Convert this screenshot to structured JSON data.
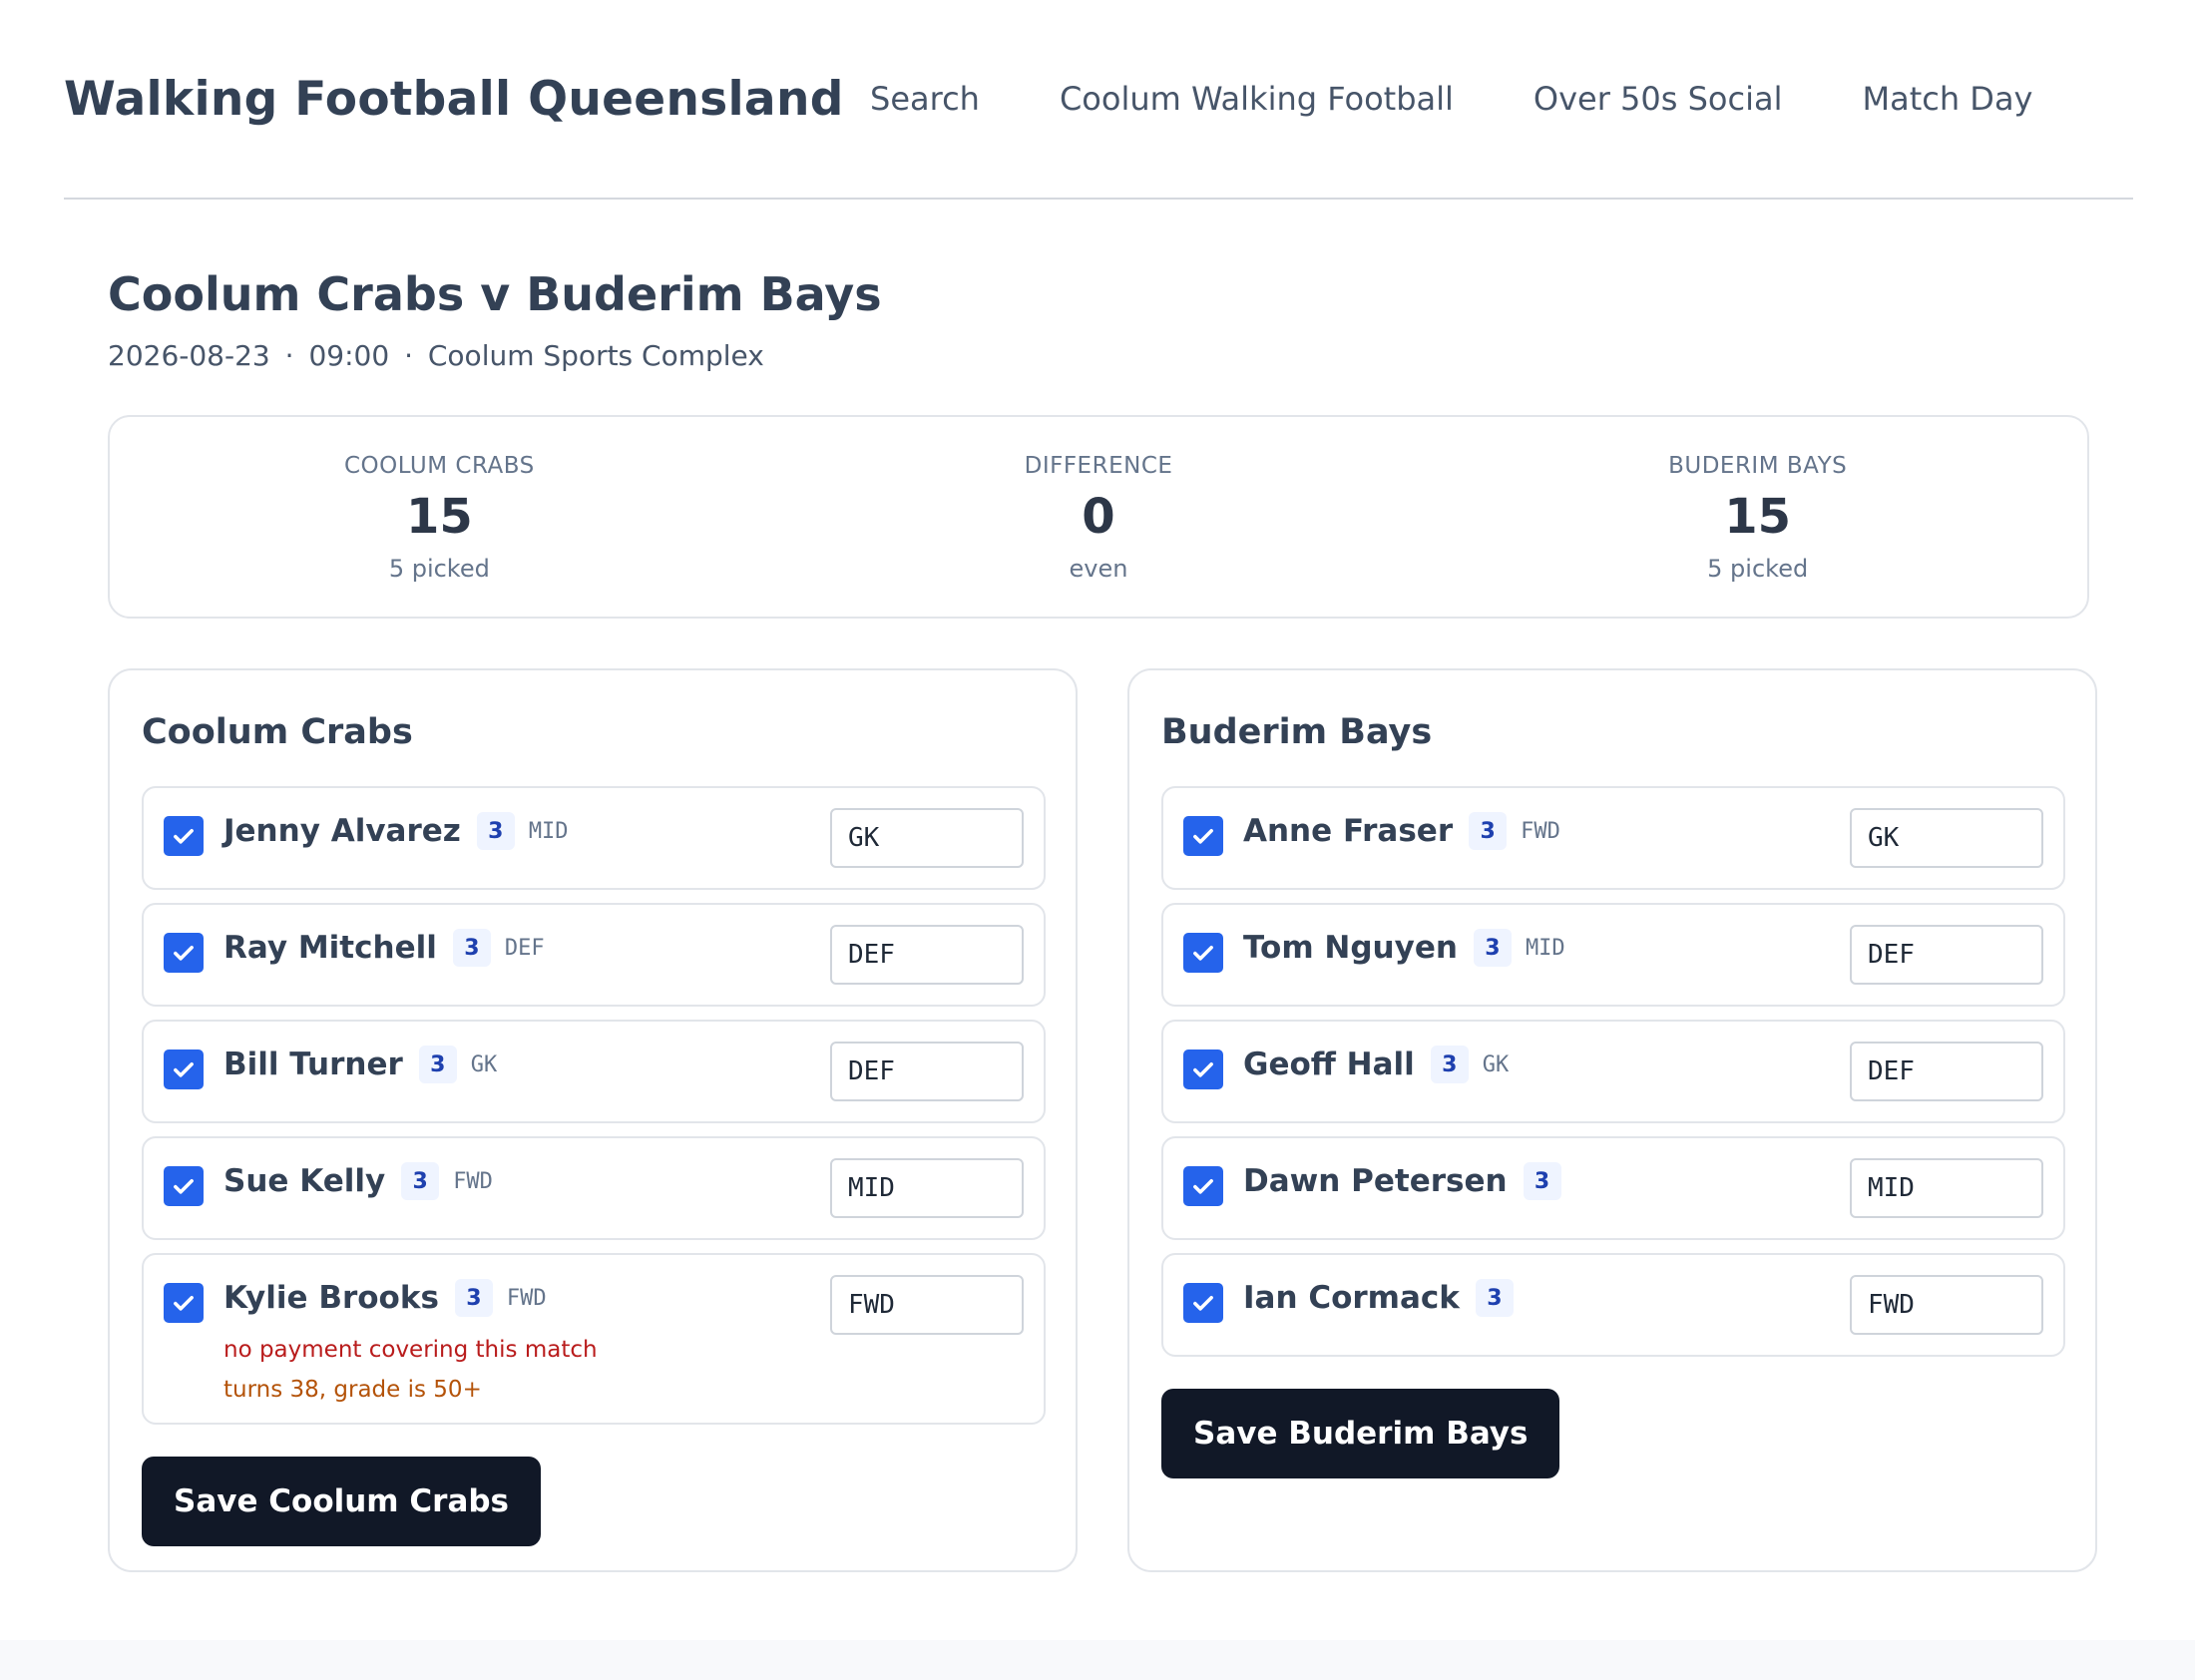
{
  "header": {
    "brand": "Walking Football Queensland",
    "nav": [
      "Search",
      "Coolum Walking Football",
      "Over 50s Social",
      "Match Day"
    ]
  },
  "match": {
    "title": "Coolum Crabs v Buderim Bays",
    "date": "2026-08-23",
    "time": "09:00",
    "venue": "Coolum Sports Complex",
    "separator": "·"
  },
  "summary": {
    "home": {
      "label": "COOLUM CRABS",
      "value": "15",
      "sub": "5 picked"
    },
    "diff": {
      "label": "DIFFERENCE",
      "value": "0",
      "sub": "even"
    },
    "away": {
      "label": "BUDERIM BAYS",
      "value": "15",
      "sub": "5 picked"
    }
  },
  "teams": {
    "home": {
      "name": "Coolum Crabs",
      "save_label": "Save Coolum Crabs",
      "players": [
        {
          "name": "Jenny Alvarez",
          "grade": "3",
          "pref": "MID",
          "position": "GK",
          "checked": true
        },
        {
          "name": "Ray Mitchell",
          "grade": "3",
          "pref": "DEF",
          "position": "DEF",
          "checked": true
        },
        {
          "name": "Bill Turner",
          "grade": "3",
          "pref": "GK",
          "position": "DEF",
          "checked": true
        },
        {
          "name": "Sue Kelly",
          "grade": "3",
          "pref": "FWD",
          "position": "MID",
          "checked": true
        },
        {
          "name": "Kylie Brooks",
          "grade": "3",
          "pref": "FWD",
          "position": "FWD",
          "checked": true,
          "warning_payment": "no payment covering this match",
          "warning_age": "turns 38, grade is 50+"
        }
      ]
    },
    "away": {
      "name": "Buderim Bays",
      "save_label": "Save Buderim Bays",
      "players": [
        {
          "name": "Anne Fraser",
          "grade": "3",
          "pref": "FWD",
          "position": "GK",
          "checked": true
        },
        {
          "name": "Tom Nguyen",
          "grade": "3",
          "pref": "MID",
          "position": "DEF",
          "checked": true
        },
        {
          "name": "Geoff Hall",
          "grade": "3",
          "pref": "GK",
          "position": "DEF",
          "checked": true
        },
        {
          "name": "Dawn Petersen",
          "grade": "3",
          "pref": "",
          "position": "MID",
          "checked": true
        },
        {
          "name": "Ian Cormack",
          "grade": "3",
          "pref": "",
          "position": "FWD",
          "checked": true
        }
      ]
    }
  },
  "icons": {
    "checkbox": "checkmark-icon"
  },
  "colors": {
    "accent": "#2563eb",
    "button": "#111827",
    "error": "#b91c1c",
    "warning": "#b45309"
  }
}
